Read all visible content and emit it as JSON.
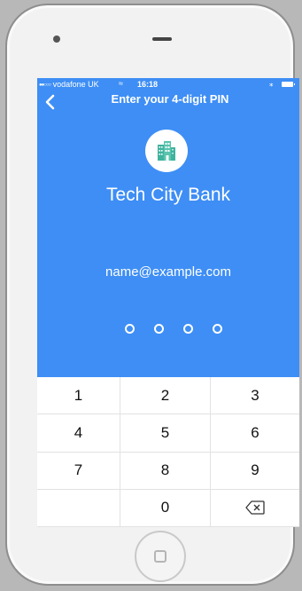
{
  "status_bar": {
    "carrier": "vodafone UK",
    "time": "16:18",
    "icons": [
      "signal-dots-icon",
      "wifi-icon",
      "bluetooth-icon",
      "battery-icon"
    ]
  },
  "header": {
    "title": "Enter your 4-digit PIN",
    "back_icon": "chevron-left-icon"
  },
  "brand": {
    "logo_icon": "building-icon",
    "name": "Tech City Bank"
  },
  "account": {
    "email": "name@example.com"
  },
  "pin": {
    "length": 4,
    "entered": 0
  },
  "keypad": {
    "keys": [
      "1",
      "2",
      "3",
      "4",
      "5",
      "6",
      "7",
      "8",
      "9",
      "",
      "0"
    ],
    "delete_icon": "backspace-icon"
  },
  "colors": {
    "primary": "#3e8ef5",
    "logo_green": "#3fb39e"
  }
}
